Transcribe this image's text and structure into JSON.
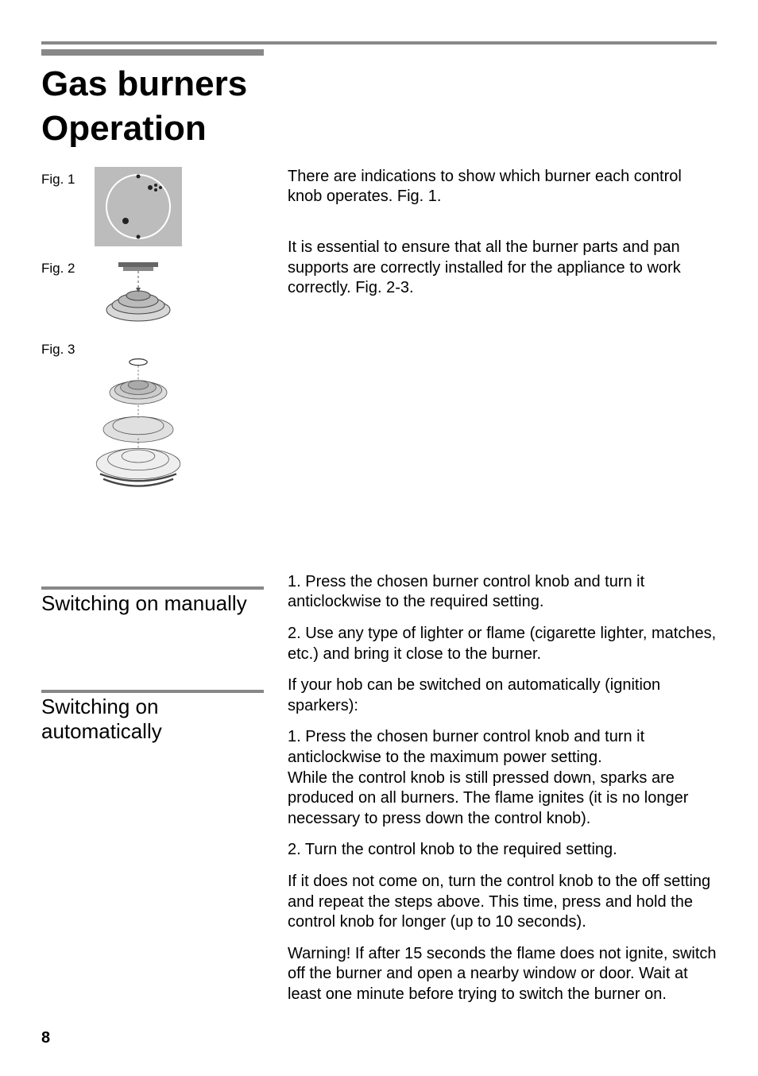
{
  "title_line1": "Gas burners",
  "title_line2": "Operation",
  "figures": {
    "fig1_label": "Fig. 1",
    "fig2_label": "Fig. 2",
    "fig3_label": "Fig. 3"
  },
  "intro": {
    "p1": "There are indications to show which burner each control knob operates. Fig. 1.",
    "p2": "It is essential to ensure that all the burner parts and pan supports are correctly installed for the appliance to work correctly. Fig. 2-3."
  },
  "sections": {
    "manual": {
      "title": "Switching on manually",
      "p1": "1. Press the chosen burner control knob and turn it anticlockwise to the required setting.",
      "p2": "2. Use any type of lighter or flame (cigarette lighter, matches, etc.) and bring it close to the burner."
    },
    "automatic": {
      "title": "Switching on automatically",
      "p0": "If your hob can be switched on automatically (ignition sparkers):",
      "p1": "1. Press the chosen burner control knob and turn it anticlockwise to the maximum power setting.\nWhile the control knob is still pressed down, sparks are produced on all burners. The flame ignites (it is no longer necessary to press down the control knob).",
      "p2": "2. Turn the control knob to the required setting.",
      "p3": "If it does not come on, turn the control knob to the off setting and repeat the steps above. This time, press and hold the control knob for longer (up to 10 seconds).",
      "p4": "Warning! If after 15 seconds the flame does not ignite, switch off the burner and open a nearby window or door. Wait at least one minute before trying to switch the burner on."
    }
  },
  "page_number": "8"
}
